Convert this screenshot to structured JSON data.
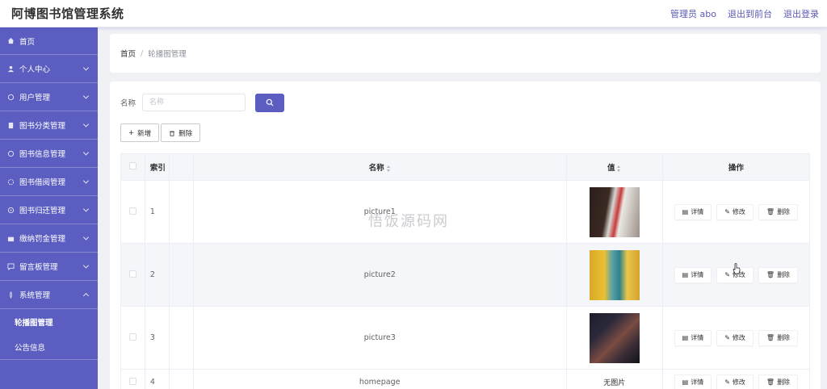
{
  "header": {
    "title": "阿博图书馆管理系统",
    "user_label": "管理员 abo",
    "front_link": "退出到前台",
    "logout_link": "退出登录"
  },
  "sidebar": {
    "items": [
      {
        "label": "首页",
        "icon": "home-icon"
      },
      {
        "label": "个人中心",
        "icon": "user-icon"
      },
      {
        "label": "用户管理",
        "icon": "users-icon"
      },
      {
        "label": "图书分类管理",
        "icon": "category-icon"
      },
      {
        "label": "图书信息管理",
        "icon": "book-icon"
      },
      {
        "label": "图书借阅管理",
        "icon": "borrow-icon"
      },
      {
        "label": "图书归还管理",
        "icon": "return-icon"
      },
      {
        "label": "缴纳罚金管理",
        "icon": "fine-icon"
      },
      {
        "label": "留言板管理",
        "icon": "message-icon"
      },
      {
        "label": "系统管理",
        "icon": "system-icon"
      }
    ],
    "sub_items": [
      {
        "label": "轮播图管理"
      },
      {
        "label": "公告信息"
      }
    ]
  },
  "breadcrumb": {
    "home": "首页",
    "separator": "/",
    "current": "轮播图管理"
  },
  "search": {
    "label": "名称",
    "placeholder": "名称"
  },
  "actions": {
    "add_label": "新增",
    "delete_label": "删除"
  },
  "table": {
    "headers": {
      "index": "索引",
      "name": "名称",
      "value": "值",
      "operation": "操作"
    },
    "rows": [
      {
        "index": "1",
        "name": "picture1",
        "value": "image"
      },
      {
        "index": "2",
        "name": "picture2",
        "value": "image"
      },
      {
        "index": "3",
        "name": "picture3",
        "value": "image"
      },
      {
        "index": "4",
        "name": "homepage",
        "value": "无图片"
      }
    ],
    "op_detail": "详情",
    "op_edit": "修改",
    "op_delete": "删除"
  },
  "watermark": "悟饭源码网",
  "colors": {
    "accent": "#5b5ec0",
    "sidebar_bg": "#5b5ec0"
  }
}
